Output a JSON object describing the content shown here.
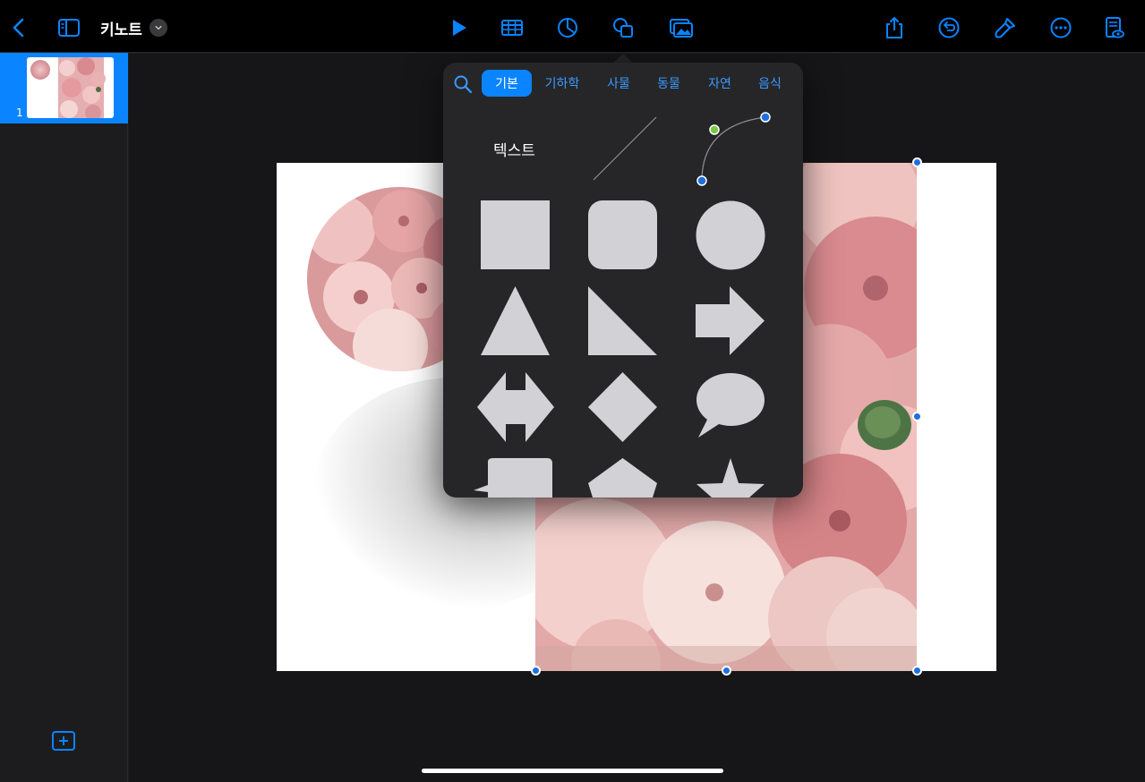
{
  "app": {
    "title": "키노트"
  },
  "colors": {
    "accent": "#0a84ff",
    "shape_fill": "#d1d1d6",
    "popover_bg": "#262628"
  },
  "toolbar": {
    "left": [
      "back-icon",
      "sidebar-toggle-icon"
    ],
    "center": [
      "play-icon",
      "table-icon",
      "chart-icon",
      "shapes-icon",
      "media-icon"
    ],
    "right": [
      "share-icon",
      "undo-icon",
      "format-brush-icon",
      "more-icon",
      "presenter-view-icon"
    ]
  },
  "sidebar": {
    "slides": [
      {
        "number": "1",
        "selected": true
      }
    ]
  },
  "shapes_popover": {
    "tabs": [
      "기본",
      "기하학",
      "사물",
      "동물",
      "자연",
      "음식"
    ],
    "active_tab": "기본",
    "text_label": "텍스트",
    "shapes": [
      "square",
      "rounded-square",
      "circle",
      "triangle",
      "right-triangle",
      "arrow-right",
      "double-arrow",
      "diamond",
      "speech-bubble",
      "callout-rectangle",
      "pentagon",
      "star"
    ]
  }
}
